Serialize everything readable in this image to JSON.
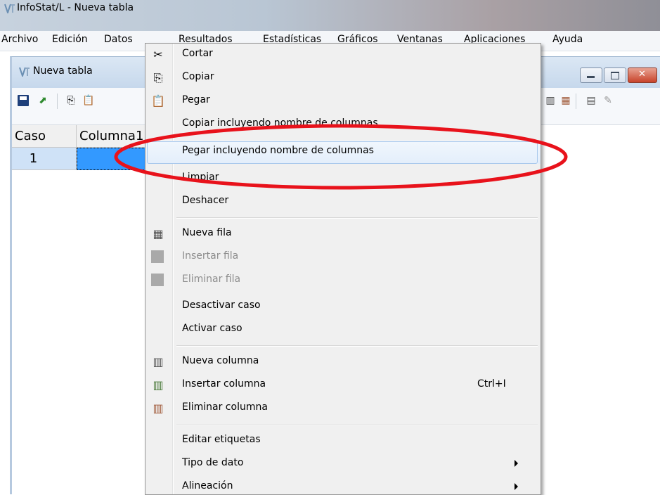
{
  "app": {
    "title": "InfoStat/L - Nueva tabla",
    "menus": [
      "Archivo",
      "Edición",
      "Datos",
      "Resultados",
      "Estadísticas",
      "Gráficos",
      "Ventanas",
      "Aplicaciones",
      "Ayuda"
    ]
  },
  "child_window": {
    "title": "Nueva tabla",
    "columns": [
      "Caso",
      "Columna1"
    ],
    "rows": [
      {
        "caso": "1",
        "value": ""
      }
    ]
  },
  "context_menu": {
    "groups": [
      [
        {
          "label": "Cortar",
          "icon": "scissors-icon",
          "enabled": true
        },
        {
          "label": "Copiar",
          "icon": "copy-icon",
          "enabled": true
        },
        {
          "label": "Pegar",
          "icon": "paste-icon",
          "enabled": true
        },
        {
          "label": "Copiar incluyendo nombre de columnas",
          "icon": "",
          "enabled": true
        },
        {
          "label": "Pegar incluyendo nombre de columnas",
          "icon": "",
          "enabled": true,
          "highlighted": true
        },
        {
          "label": "Limpiar",
          "icon": "",
          "enabled": true
        },
        {
          "label": "Deshacer",
          "icon": "",
          "enabled": true
        }
      ],
      [
        {
          "label": "Nueva fila",
          "icon": "new-row-icon",
          "enabled": true
        },
        {
          "label": "Insertar fila",
          "icon": "insert-row-icon",
          "enabled": false
        },
        {
          "label": "Eliminar fila",
          "icon": "delete-row-icon",
          "enabled": false
        },
        {
          "label": "Desactivar caso",
          "icon": "",
          "enabled": true
        },
        {
          "label": "Activar caso",
          "icon": "",
          "enabled": true
        }
      ],
      [
        {
          "label": "Nueva columna",
          "icon": "new-column-icon",
          "enabled": true
        },
        {
          "label": "Insertar columna",
          "icon": "insert-column-icon",
          "enabled": true,
          "shortcut": "Ctrl+I"
        },
        {
          "label": "Eliminar columna",
          "icon": "delete-column-icon",
          "enabled": true
        }
      ],
      [
        {
          "label": "Editar etiquetas",
          "icon": "",
          "enabled": true
        },
        {
          "label": "Tipo de dato",
          "icon": "",
          "enabled": true,
          "submenu": true
        },
        {
          "label": "Alineación",
          "icon": "",
          "enabled": true,
          "submenu": true
        }
      ]
    ]
  },
  "colors": {
    "annotation": "#e8121b",
    "selected_cell": "#3399ff",
    "row_header_selected": "#cfe2f7"
  }
}
